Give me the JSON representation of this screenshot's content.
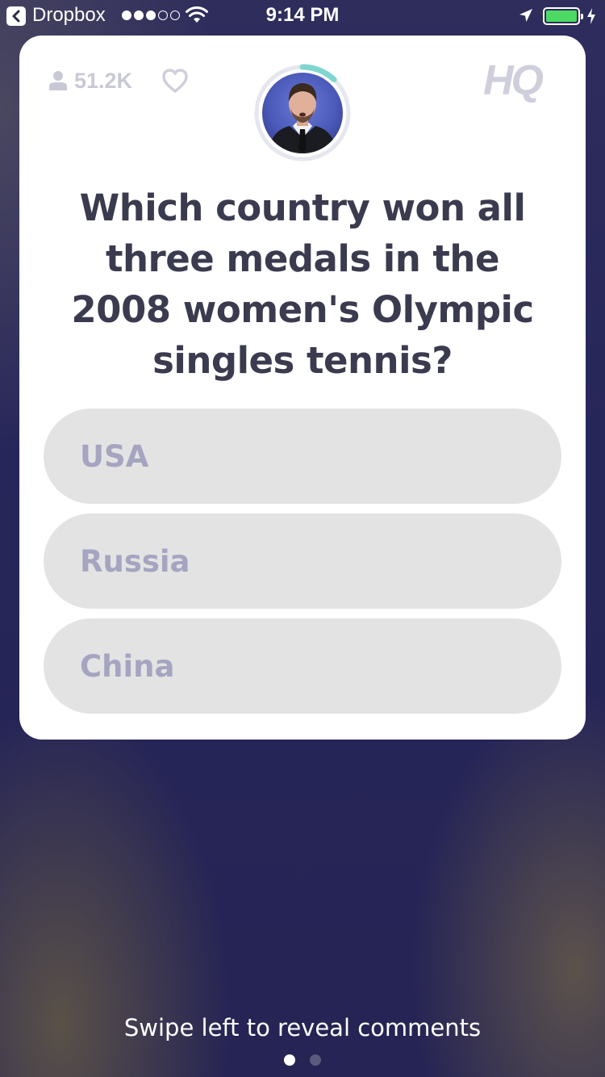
{
  "status_bar": {
    "back_app": "Dropbox",
    "time": "9:14 PM",
    "signal_bars_filled": 3,
    "signal_bars_total": 5,
    "battery_level": 1.0
  },
  "card": {
    "viewers_count": "51.2K",
    "logo_text": "HQ",
    "host_timer_progress": 0.12,
    "question": "Which country won all three medals in the 2008 women's Olympic singles tennis?",
    "answers": [
      {
        "label": "USA"
      },
      {
        "label": "Russia"
      },
      {
        "label": "China"
      }
    ]
  },
  "footer": {
    "hint": "Swipe left to reveal comments",
    "pages_total": 2,
    "page_active": 1
  },
  "colors": {
    "background": "#262454",
    "card": "#ffffff",
    "answer_bg": "#e3e3e3",
    "answer_text": "#a5a5c1",
    "question_text": "#3b3b4f",
    "timer_ring": "#7fd6d0",
    "battery": "#4cd964"
  }
}
